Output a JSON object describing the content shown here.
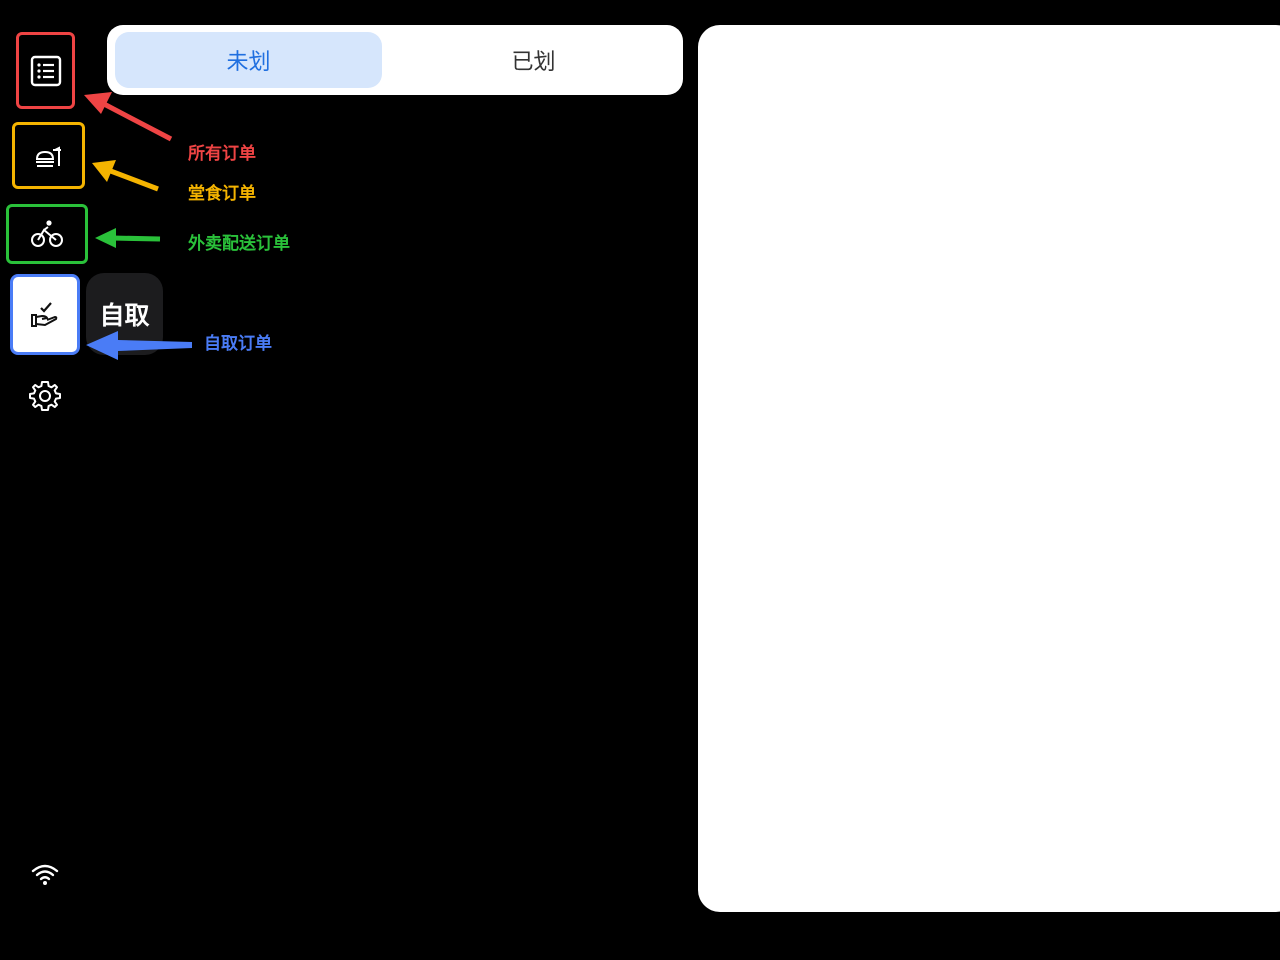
{
  "tabs": {
    "unassigned": "未划",
    "assigned": "已划"
  },
  "sidebar": {
    "items": [
      {
        "name": "all-orders",
        "icon": "list-icon",
        "border_color": "#ef4444"
      },
      {
        "name": "dine-in",
        "icon": "dine-in-icon",
        "border_color": "#f5b400"
      },
      {
        "name": "delivery",
        "icon": "bicycle-icon",
        "border_color": "#2ac13a"
      },
      {
        "name": "pickup",
        "icon": "hand-check-icon",
        "border_color": "#4a7cf6",
        "selected": true
      }
    ],
    "settings_icon": "gear-icon",
    "wifi_icon": "wifi-icon"
  },
  "tooltip": {
    "label": "自取"
  },
  "annotations": [
    {
      "text": "所有订单",
      "color": "#ef4444"
    },
    {
      "text": "堂食订单",
      "color": "#f5b400"
    },
    {
      "text": "外卖配送订单",
      "color": "#2ac13a"
    },
    {
      "text": "自取订单",
      "color": "#4a7cf6"
    }
  ]
}
